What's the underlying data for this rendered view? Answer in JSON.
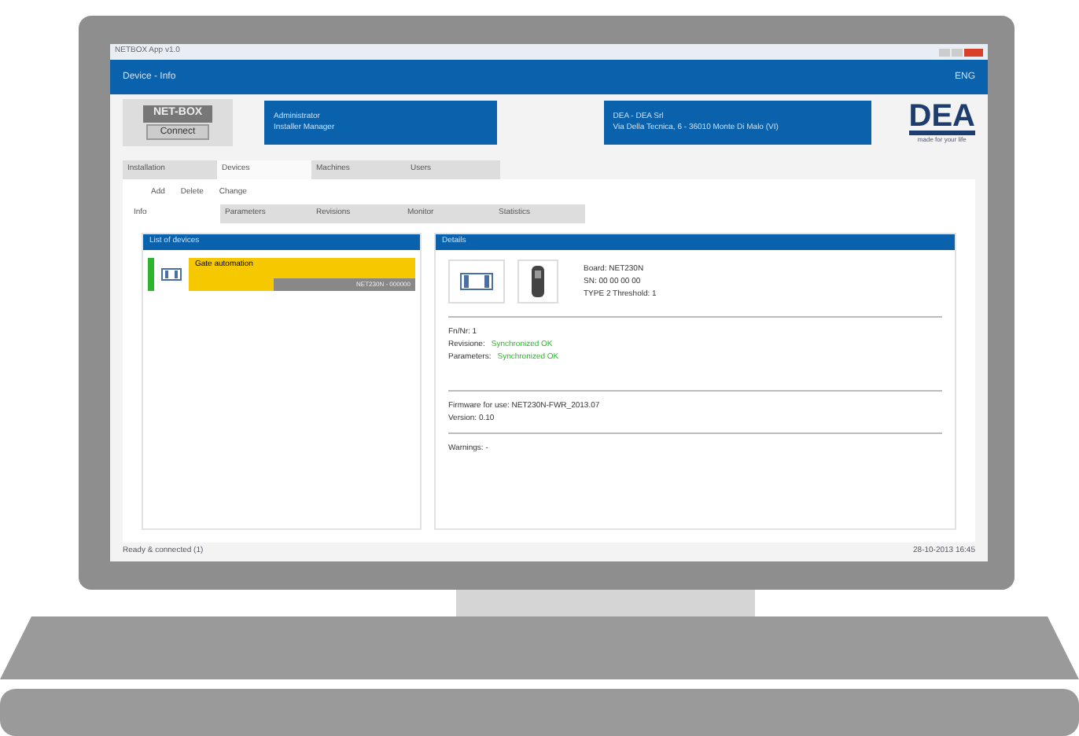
{
  "window": {
    "title": "NETBOX App v1.0"
  },
  "menu_bar": {
    "title": "Device - Info",
    "language": "ENG"
  },
  "device_box": {
    "name": "NET-BOX",
    "button": "Connect"
  },
  "user_box": {
    "line_1": "Administrator",
    "line_2": "Installer Manager"
  },
  "company_box": {
    "line_1": "DEA - DEA Srl",
    "line_2": "Via Della Tecnica, 6 - 36010 Monte Di Malo (VI)"
  },
  "logo": {
    "text": "DEA",
    "tagline": "made for your life"
  },
  "main_tabs": [
    {
      "label": "Installation",
      "selected": false
    },
    {
      "label": "Devices",
      "selected": true
    },
    {
      "label": "Machines",
      "selected": false
    },
    {
      "label": "Users",
      "selected": false
    }
  ],
  "toolbar": [
    "Add",
    "Delete",
    "Change"
  ],
  "sub_tabs": [
    {
      "label": "Info",
      "selected": true
    },
    {
      "label": "Parameters",
      "selected": false
    },
    {
      "label": "Revisions",
      "selected": false
    },
    {
      "label": "Monitor",
      "selected": false
    },
    {
      "label": "Statistics",
      "selected": false
    }
  ],
  "device_list": {
    "title": "List of devices",
    "items": [
      {
        "name": "Gate automation",
        "status": "NET230N - 000000",
        "color": "#2db52d"
      }
    ]
  },
  "details": {
    "title": "Details",
    "lines_1": [
      "Board: NET230N",
      "SN: 00 00 00 00",
      "TYPE 2 Threshold: 1"
    ],
    "lines_2": [
      {
        "label": "Fn/Nr: 1"
      },
      {
        "label": "Revisione:",
        "value": "Synchronized OK"
      },
      {
        "label": "Parameters:",
        "value": "Synchronized OK"
      }
    ],
    "lines_3": [
      "Firmware for use: NET230N-FWR_2013.07",
      "Version: 0.10"
    ],
    "lines_4": [
      "Warnings: -"
    ]
  },
  "status_bar": {
    "left": "Ready & connected (1)",
    "right": "28-10-2013 16:45"
  }
}
